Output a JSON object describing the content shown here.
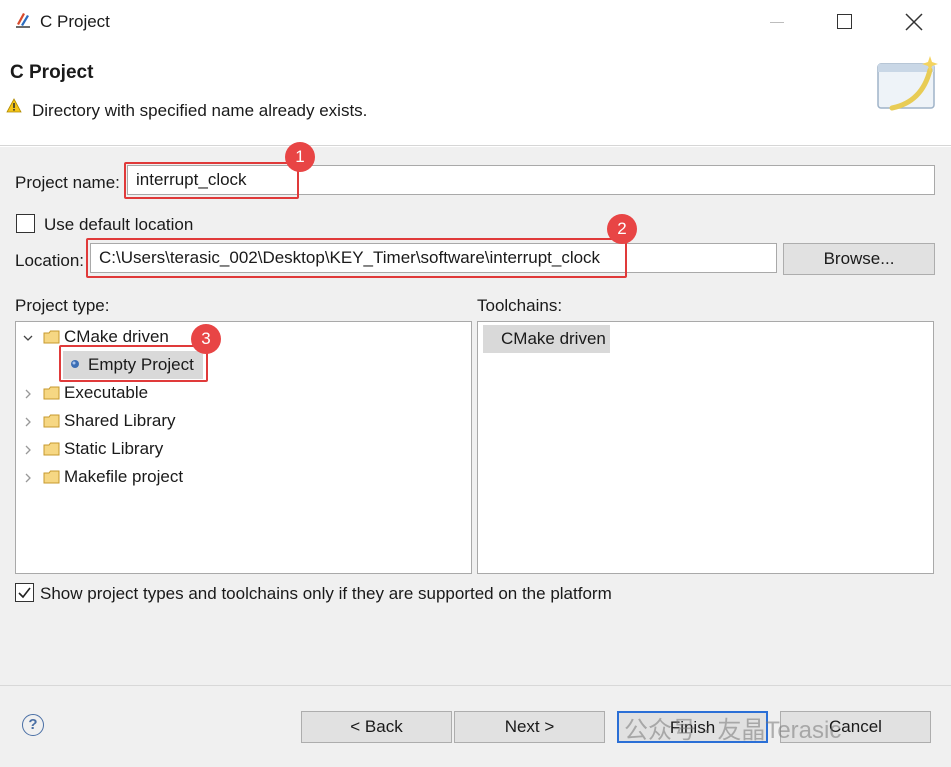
{
  "window": {
    "title": "C Project"
  },
  "banner": {
    "title": "C Project",
    "message": "Directory with specified name already exists."
  },
  "form": {
    "project_name_label": "Project name:",
    "project_name_value": "interrupt_clock",
    "use_default_location_label": "Use default location",
    "use_default_location_checked": false,
    "location_label": "Location:",
    "location_value": "C:\\Users\\terasic_002\\Desktop\\KEY_Timer\\software\\interrupt_clock",
    "browse_label": "Browse..."
  },
  "project_type": {
    "label": "Project type:",
    "items": [
      {
        "label": "CMake driven",
        "expanded": true,
        "children": [
          {
            "label": "Empty Project",
            "selected": true
          }
        ]
      },
      {
        "label": "Executable",
        "expanded": false
      },
      {
        "label": "Shared Library",
        "expanded": false
      },
      {
        "label": "Static Library",
        "expanded": false
      },
      {
        "label": "Makefile project",
        "expanded": false
      }
    ]
  },
  "toolchains": {
    "label": "Toolchains:",
    "items": [
      {
        "label": "CMake driven",
        "selected": true
      }
    ]
  },
  "filter": {
    "label": "Show project types and toolchains only if they are supported on the platform",
    "checked": true
  },
  "annotations": [
    "1",
    "2",
    "3"
  ],
  "buttons": {
    "back": "< Back",
    "next": "Next >",
    "finish": "Finish",
    "cancel": "Cancel"
  },
  "watermark": "公众号 · 友晶Terasic",
  "icons": {
    "app": "eclipse-cdt-icon",
    "warning": "warning-icon",
    "help": "help-icon",
    "folder": "folder-icon",
    "wizard": "wizard-banner-graphic"
  },
  "colors": {
    "annotation_red": "#e84545",
    "selection_gray": "#d9d9d9",
    "dialog_bg": "#f0f0f0"
  }
}
